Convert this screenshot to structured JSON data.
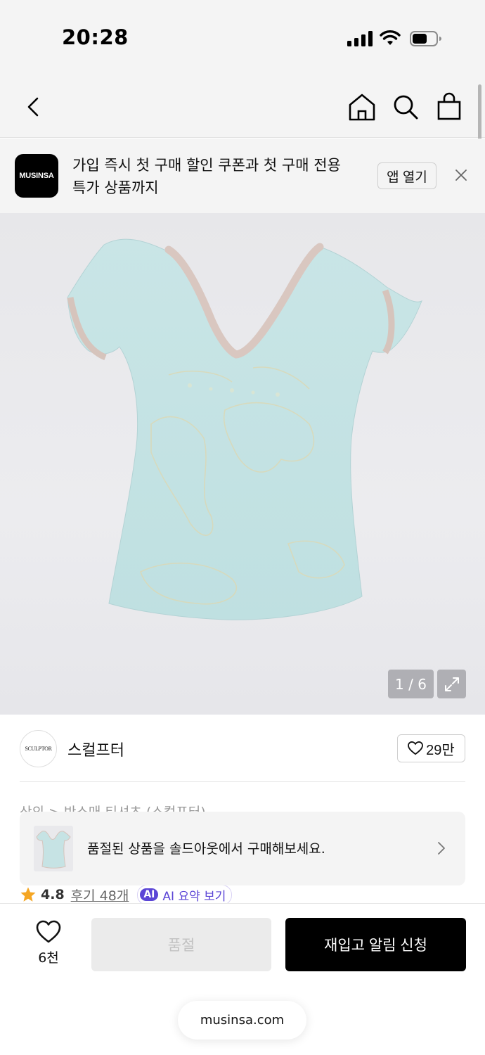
{
  "status": {
    "time": "20:28",
    "icons": [
      "signal-icon",
      "wifi-icon",
      "battery-icon"
    ]
  },
  "header": {
    "icons": [
      "back-icon",
      "home-icon",
      "search-icon",
      "bag-icon"
    ]
  },
  "app_banner": {
    "logo_text": "MUSINSA",
    "text": "가입 즉시 첫 구매 할인 쿠폰과 첫 구매 전용 특가 상품까지",
    "open_label": "앱 열기",
    "close_icon": "close-icon"
  },
  "product": {
    "image_counter": "1 / 6",
    "expand_icon": "expand-icon"
  },
  "brand": {
    "logo_text": "SCULPTOR",
    "name": "스컬프터",
    "like_count": "29만"
  },
  "breadcrumb": "상의 > 반소매 티셔츠 (스컬프터)",
  "soldout_card": {
    "text": "품절된 상품을 솔드아웃에서 구매해보세요."
  },
  "rating": {
    "value": "4.8",
    "review_link": "후기 48개",
    "ai_badge": "AI",
    "ai_summary": "AI 요약 보기"
  },
  "bottom_bar": {
    "wish_count": "6천",
    "soldout_label": "품절",
    "restock_label": "재입고 알림 신청",
    "url": "musinsa.com"
  },
  "colors": {
    "background": "#f4f4f4",
    "primary_button": "#000000",
    "disabled_button": "#ebebeb",
    "ai_accent": "#5b45d6",
    "star": "#f5a623"
  }
}
